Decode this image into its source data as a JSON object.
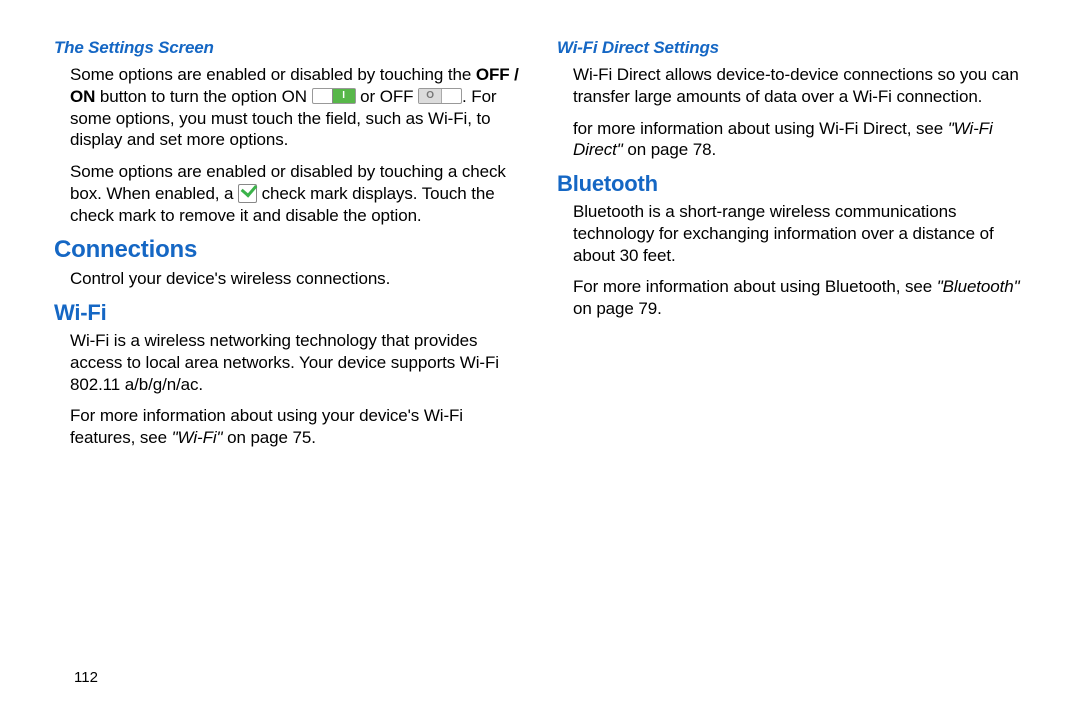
{
  "left": {
    "h_settings": "The Settings Screen",
    "p1_a": "Some options are enabled or disabled by touching the ",
    "p1_bold": "OFF / ON",
    "p1_b": " button to turn the option ON ",
    "p1_c": " or OFF ",
    "p1_d": ". For some options, you must touch the field, such as Wi-Fi, to display and set more options.",
    "p2_a": "Some options are enabled or disabled by touching a check box. When enabled, a ",
    "p2_b": " check mark displays. Touch the check mark to remove it and disable the option.",
    "h_connections": "Connections",
    "p3": "Control your device's wireless connections.",
    "h_wifi": "Wi-Fi",
    "p4": "Wi-Fi is a wireless networking technology that provides access to local area networks. Your device supports Wi-Fi 802.11 a/b/g/n/ac.",
    "p5_a": "For more information about using your device's Wi-Fi features, see ",
    "p5_ref": "\"Wi-Fi\"",
    "p5_b": " on page 75."
  },
  "right": {
    "h_wfd": "Wi-Fi Direct Settings",
    "p1": "Wi-Fi Direct allows device-to-device connections so you can transfer large amounts of data over a Wi-Fi connection.",
    "p2_a": "for more information about using Wi-Fi Direct, see ",
    "p2_ref": "\"Wi-Fi Direct\"",
    "p2_b": " on page 78.",
    "h_bt": "Bluetooth",
    "p3": "Bluetooth is a short-range wireless communications technology for exchanging information over a distance of about 30 feet.",
    "p4_a": "For more information about using Bluetooth, see ",
    "p4_ref": "\"Bluetooth\"",
    "p4_b": " on page 79."
  },
  "pagenum": "112"
}
